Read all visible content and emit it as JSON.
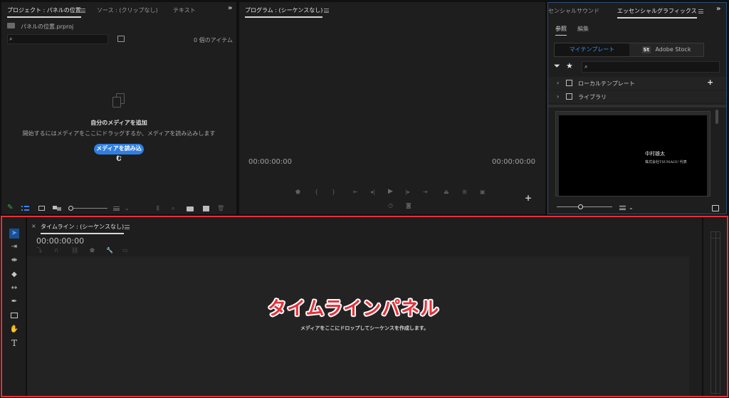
{
  "project_panel": {
    "tab_project": "プロジェクト : パネルの位置",
    "tab_source": "ソース : (クリップなし)",
    "tab_text": "テキスト",
    "overflow": "»",
    "file_name": "パネルの位置.prproj",
    "item_count": "0 個のアイテム",
    "empty_title": "自分のメディアを追加",
    "empty_desc": "開始するにはメディアをここにドラッグするか、メディアを読み込みします",
    "import_button": "メディアを読み込む"
  },
  "program_panel": {
    "tab_program": "プログラム : (シーケンスなし)",
    "timecode_left": "00:00:00:00",
    "timecode_right": "00:00:00:00"
  },
  "graphics_panel": {
    "tab_sound": "センシャルサウンド",
    "tab_graphics": "エッセンシャルグラフィックス",
    "overflow": "»",
    "subtab_browse": "参照",
    "subtab_edit": "編集",
    "btn_my_templates": "マイテンプレート",
    "btn_adobe_stock_badge": "St",
    "btn_adobe_stock": "Adobe Stock",
    "tree_local": "ローカルテンプレート",
    "tree_library": "ライブラリ",
    "preview_name": "中村雄太",
    "preview_company": "株式会社TSUNAGU 代表"
  },
  "timeline_panel": {
    "close": "×",
    "tab_timeline": "タイムライン : (シーケンスなし)",
    "timecode": "00:00:00:00",
    "overlay_label": "タイムラインパネル",
    "drop_message": "メディアをここにドロップしてシーケンスを作成します。"
  },
  "colors": {
    "accent_blue": "#2f7fe0",
    "highlight_red": "#e8303a",
    "panel_bg": "#1e1e1e"
  }
}
